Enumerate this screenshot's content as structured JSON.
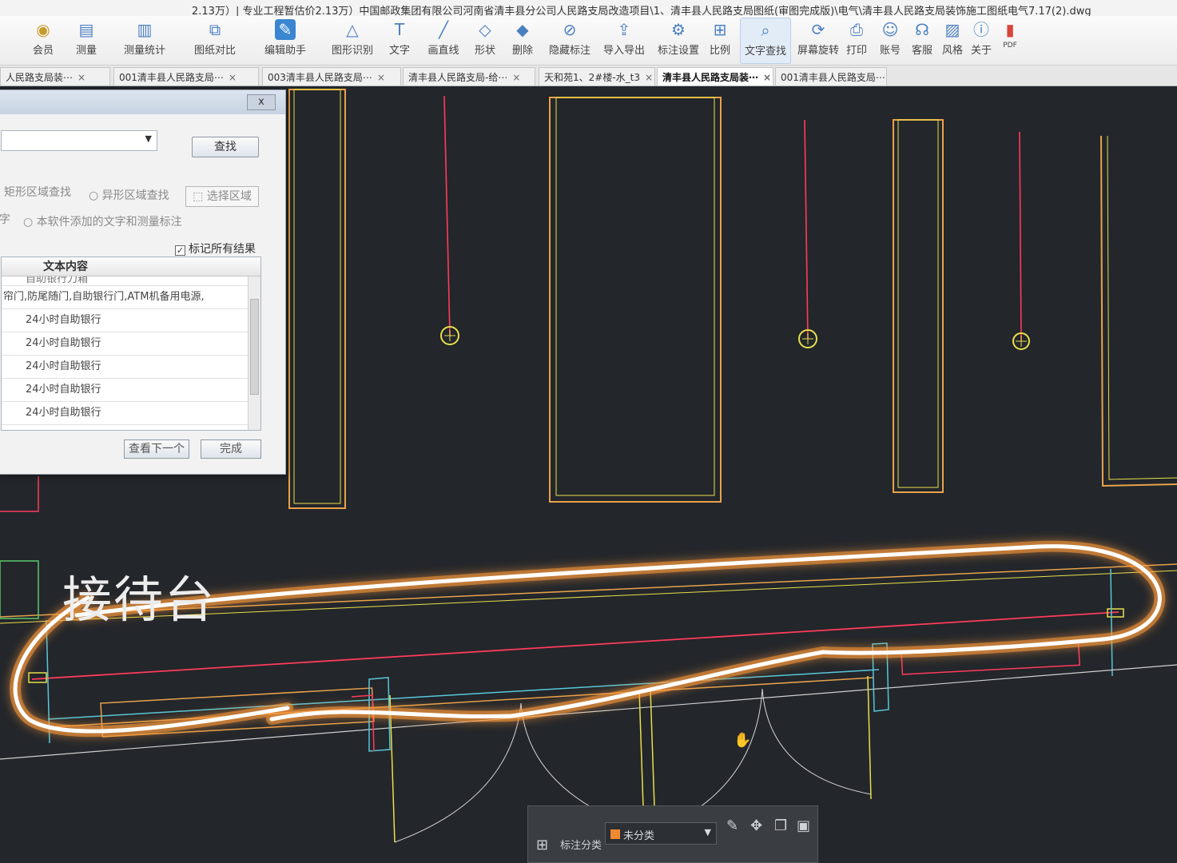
{
  "app": {
    "title_path": "2.13万）| 专业工程暂估价2.13万）中国邮政集团有限公司河南省清丰县分公司人民路支局改造项目\\1、清丰县人民路支局图纸(审图完成版)\\电气\\清丰县人民路支局装饰施工图纸电气7.17(2).dwg"
  },
  "ribbon": {
    "items": [
      {
        "label": "员",
        "icon": "file-icon"
      },
      {
        "label": "会员",
        "icon": "vip-icon"
      },
      {
        "label": "测量",
        "icon": "ruler-icon"
      },
      {
        "label": "测量统计",
        "icon": "stats-icon"
      },
      {
        "label": "图纸对比",
        "icon": "compare-icon"
      },
      {
        "label": "编辑助手",
        "icon": "edit-assistant-icon"
      },
      {
        "label": "图形识别",
        "icon": "shape-recognize-icon"
      },
      {
        "label": "文字",
        "icon": "text-icon"
      },
      {
        "label": "画直线",
        "icon": "line-icon"
      },
      {
        "label": "形状",
        "icon": "shape-icon"
      },
      {
        "label": "删除",
        "icon": "eraser-icon"
      },
      {
        "label": "隐藏标注",
        "icon": "hide-annotation-icon"
      },
      {
        "label": "导入导出",
        "icon": "import-export-icon"
      },
      {
        "label": "标注设置",
        "icon": "annotation-settings-icon"
      },
      {
        "label": "比例",
        "icon": "scale-icon"
      },
      {
        "label": "文字查找",
        "icon": "text-search-icon"
      },
      {
        "label": "屏幕旋转",
        "icon": "rotate-icon"
      },
      {
        "label": "打印",
        "icon": "print-icon"
      },
      {
        "label": "账号",
        "icon": "account-icon"
      },
      {
        "label": "客服",
        "icon": "headset-icon"
      },
      {
        "label": "风格",
        "icon": "style-icon"
      },
      {
        "label": "关于",
        "icon": "info-icon"
      },
      {
        "label": "PDF",
        "icon": "pdf-icon"
      }
    ]
  },
  "tabs": [
    {
      "label": "人民路支局装⋯",
      "active": false
    },
    {
      "label": "001清丰县人民路支局⋯",
      "active": false
    },
    {
      "label": "003清丰县人民路支局⋯",
      "active": false
    },
    {
      "label": "清丰县人民路支局-给⋯",
      "active": false
    },
    {
      "label": "天和苑1、2#楼-水_t3",
      "active": false
    },
    {
      "label": "清丰县人民路支局装⋯",
      "active": true
    },
    {
      "label": "001清丰县人民路支局⋯",
      "active": false
    }
  ],
  "dialog": {
    "close": "x",
    "find_button": "查找",
    "option_rect": "矩形区域查找",
    "option_irregular": "异形区域查找",
    "select_area": "选择区域",
    "option_text_prefix": "字",
    "option_software_text": "本软件添加的文字和测量标注",
    "mark_all": "标记所有结果",
    "list_header": "文本内容",
    "rows": [
      "自助银行刀箱",
      "帘门,防尾随门,自助银行门,ATM机备用电源,",
      "24小时自助银行",
      "24小时自助银行",
      "24小时自助银行",
      "24小时自助银行",
      "24小时自助银行"
    ],
    "next_button": "查看下一个",
    "done_button": "完成"
  },
  "canvas": {
    "reception_label": "接待台"
  },
  "annotation_bar": {
    "label": "标注分类",
    "selected": "未分类",
    "swatch_color": "#f08a30"
  },
  "colors": {
    "canvas_bg": "#23262b",
    "wall_orange": "#e9a24a",
    "red_line": "#ff3b5c",
    "cyan_line": "#58c7d8",
    "yellow_line": "#e8e04a",
    "highlight_stroke": "#ffffff",
    "highlight_glow": "#ff9a3a"
  }
}
